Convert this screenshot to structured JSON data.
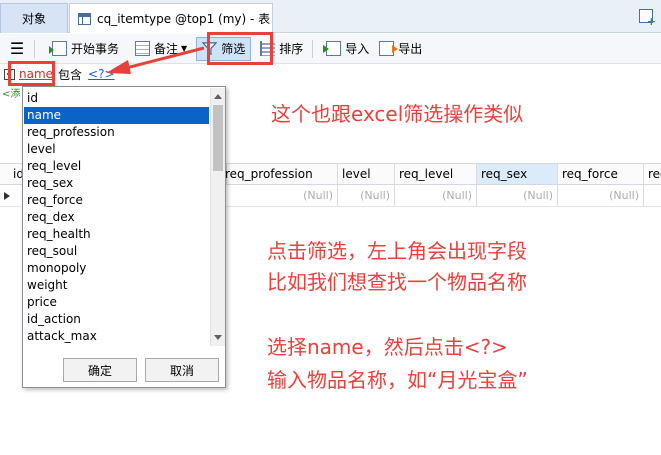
{
  "tabs": {
    "objects": "对象",
    "table": "cq_itemtype @top1 (my) - 表"
  },
  "toolbar": {
    "begin_tx": "开始事务",
    "note": "备注",
    "filter": "筛选",
    "sort": "排序",
    "import": "导入",
    "export": "导出"
  },
  "filterbar": {
    "field": "name",
    "operator": "包含",
    "value": "<?>",
    "hint": "<添"
  },
  "dropdown": {
    "items": [
      "id",
      "name",
      "req_profession",
      "level",
      "req_level",
      "req_sex",
      "req_force",
      "req_dex",
      "req_health",
      "req_soul",
      "monopoly",
      "weight",
      "price",
      "id_action",
      "attack_max"
    ],
    "selected": "name",
    "ok": "确定",
    "cancel": "取消"
  },
  "grid": {
    "partial_first_col": "id",
    "columns": [
      "req_profession",
      "level",
      "req_level",
      "req_sex",
      "req_force",
      "req"
    ],
    "selected_column": "req_sex",
    "null_text": "(Null)"
  },
  "annotations": {
    "line1": "这个也跟excel筛选操作类似",
    "line2": "点击筛选，左上角会出现字段",
    "line3": "比如我们想查找一个物品名称",
    "line4": "选择name，然后点击<?>",
    "line5": "输入物品名称，如“月光宝盒”"
  },
  "colors": {
    "highlight_red": "#e8413b",
    "selection_blue": "#0a64c8"
  }
}
